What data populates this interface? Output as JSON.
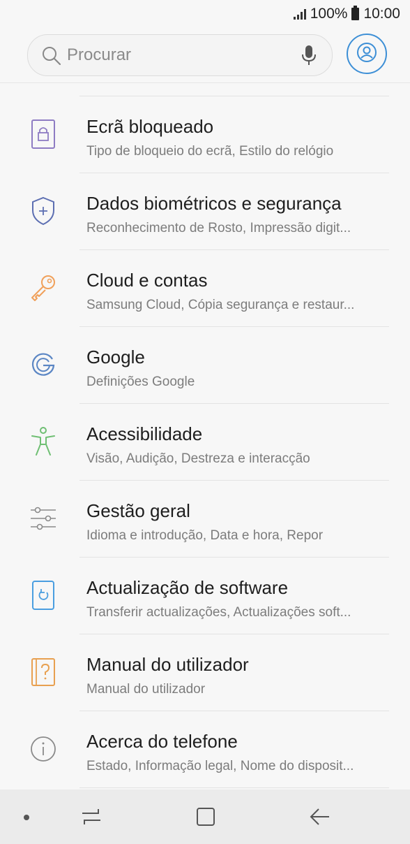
{
  "status_bar": {
    "battery_text": "100%",
    "time": "10:00"
  },
  "search": {
    "placeholder": "Procurar"
  },
  "settings_items": [
    {
      "icon": "lock-screen-icon",
      "color": "#8e7cc3",
      "title": "Ecrã bloqueado",
      "subtitle": "Tipo de bloqueio do ecrã, Estilo do relógio"
    },
    {
      "icon": "shield-icon",
      "color": "#5d6fb2",
      "title": "Dados biométricos e segurança",
      "subtitle": "Reconhecimento de Rosto, Impressão digit..."
    },
    {
      "icon": "key-icon",
      "color": "#f0a05a",
      "title": "Cloud e contas",
      "subtitle": "Samsung Cloud, Cópia segurança e restaur..."
    },
    {
      "icon": "google-icon",
      "color": "#5b86c4",
      "title": "Google",
      "subtitle": "Definições Google"
    },
    {
      "icon": "accessibility-icon",
      "color": "#6fbf73",
      "title": "Acessibilidade",
      "subtitle": "Visão, Audição, Destreza e interacção"
    },
    {
      "icon": "sliders-icon",
      "color": "#8a8a8a",
      "title": "Gestão geral",
      "subtitle": "Idioma e introdução, Data e hora, Repor"
    },
    {
      "icon": "software-update-icon",
      "color": "#4a9ee0",
      "title": "Actualização de software",
      "subtitle": "Transferir actualizações, Actualizações soft..."
    },
    {
      "icon": "manual-icon",
      "color": "#e8a050",
      "title": "Manual do utilizador",
      "subtitle": "Manual do utilizador"
    },
    {
      "icon": "info-icon",
      "color": "#8a8a8a",
      "title": "Acerca do telefone",
      "subtitle": "Estado, Informação legal, Nome do disposit..."
    }
  ],
  "colors": {
    "accent": "#3d8fd6",
    "background": "#f7f7f7"
  }
}
